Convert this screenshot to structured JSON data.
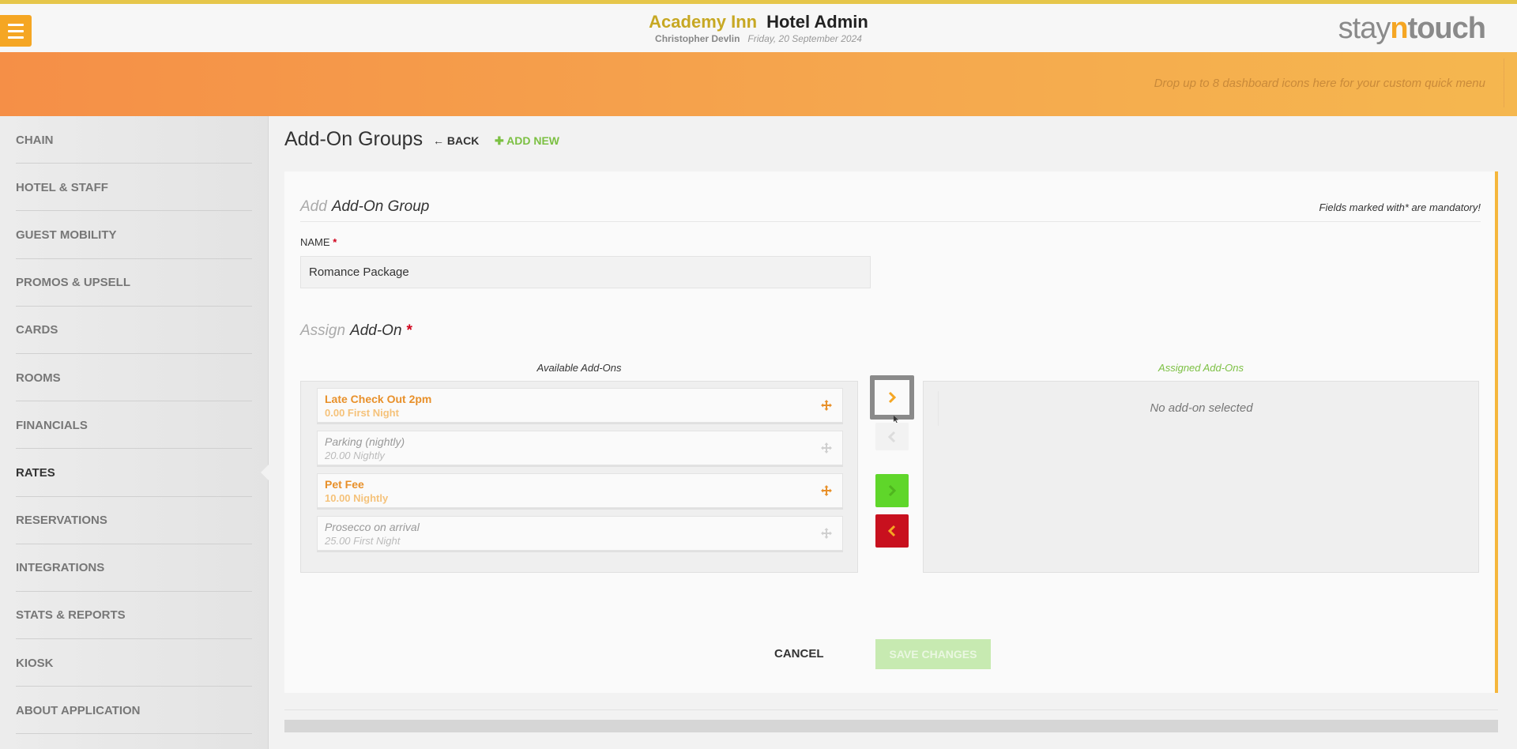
{
  "header": {
    "hotel_name": "Academy Inn",
    "app_name": "Hotel Admin",
    "user_name": "Christopher Devlin",
    "date": "Friday, 20 September 2024",
    "logo": {
      "part1": "stay",
      "part2": "n",
      "part3": "touch"
    },
    "accent_color": "#f5a623"
  },
  "quickbar": {
    "hint": "Drop up to 8 dashboard icons here for your custom quick menu"
  },
  "sidebar": {
    "items": [
      {
        "label": "CHAIN"
      },
      {
        "label": "HOTEL & STAFF"
      },
      {
        "label": "GUEST MOBILITY"
      },
      {
        "label": "PROMOS & UPSELL"
      },
      {
        "label": "CARDS"
      },
      {
        "label": "ROOMS"
      },
      {
        "label": "FINANCIALS"
      },
      {
        "label": "RATES",
        "active": true
      },
      {
        "label": "RESERVATIONS"
      },
      {
        "label": "INTEGRATIONS"
      },
      {
        "label": "STATS & REPORTS"
      },
      {
        "label": "KIOSK"
      },
      {
        "label": "ABOUT APPLICATION"
      }
    ]
  },
  "page": {
    "title": "Add-On Groups",
    "back_label": "BACK",
    "add_new_label": "ADD NEW"
  },
  "form": {
    "heading_muted": "Add",
    "heading": "Add-On Group",
    "mandatory_note": "Fields marked with* are mandatory!",
    "name_label": "NAME",
    "required_mark": "*",
    "name_value": "Romance Package",
    "assign_muted": "Assign",
    "assign_heading": "Add-On",
    "available_title": "Available Add-Ons",
    "assigned_title": "Assigned Add-Ons",
    "assigned_empty": "No add-on selected",
    "available": [
      {
        "name": "Late Check Out 2pm",
        "price": "0.00 First Night",
        "active": true
      },
      {
        "name": "Parking (nightly)",
        "price": "20.00 Nightly",
        "active": false
      },
      {
        "name": "Pet Fee",
        "price": "10.00 Nightly",
        "active": true
      },
      {
        "name": "Prosecco on arrival",
        "price": "25.00 First Night",
        "active": false
      }
    ],
    "cancel_label": "CANCEL",
    "save_label": "SAVE CHANGES"
  }
}
